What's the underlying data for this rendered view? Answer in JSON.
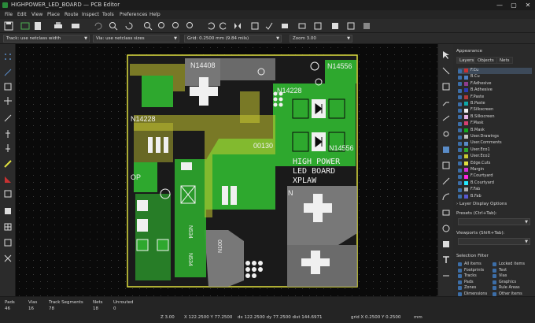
{
  "window": {
    "title": "HIGHPOWER_LED_BOARD — PCB Editor",
    "minimize": "—",
    "maximize": "▢",
    "close": "✕"
  },
  "menu": [
    "File",
    "Edit",
    "View",
    "Place",
    "Route",
    "Inspect",
    "Tools",
    "Preferences",
    "Help"
  ],
  "options": {
    "track": "Track: use netclass width",
    "via": "Via: use netclass sizes",
    "grid": "Grid: 0.2500 mm (9.84 mils)",
    "zoom": "Zoom 3.00"
  },
  "board": {
    "labels": {
      "n14408": "N14408",
      "n14556_top": "N14556",
      "n14228_right": "N14228",
      "n14228_left": "N14228",
      "n14556_mid": "N14556",
      "n00130": "00130",
      "title1": "HIGH POWER",
      "title2": "LED BOARD",
      "title3": "XPLAW",
      "n_lower": "N",
      "op": "OP",
      "n534_a": "N534",
      "n534_b": "N534",
      "n100": "N100"
    },
    "colors": {
      "fcu": "#c83232",
      "bcu": "#2ea82e",
      "yellow": "#c8c832",
      "silk": "#f0f0f0"
    }
  },
  "panel": {
    "title": "Appearance",
    "tabs": [
      "Layers",
      "Objects",
      "Nets"
    ],
    "layers": [
      {
        "name": "F.Cu",
        "color": "#c83232"
      },
      {
        "name": "B.Cu",
        "color": "#4d7fc4"
      },
      {
        "name": "F.Adhesive",
        "color": "#8f3d8f"
      },
      {
        "name": "B.Adhesive",
        "color": "#2b3bb3"
      },
      {
        "name": "F.Paste",
        "color": "#b33b3b"
      },
      {
        "name": "B.Paste",
        "color": "#0fa8a8"
      },
      {
        "name": "F.Silkscreen",
        "color": "#f0f0f0"
      },
      {
        "name": "B.Silkscreen",
        "color": "#e5b3e5"
      },
      {
        "name": "F.Mask",
        "color": "#d64073"
      },
      {
        "name": "B.Mask",
        "color": "#12a81e"
      },
      {
        "name": "User.Drawings",
        "color": "#c2c2c2"
      },
      {
        "name": "User.Comments",
        "color": "#5a8cc8"
      },
      {
        "name": "User.Eco1",
        "color": "#2ea82e"
      },
      {
        "name": "User.Eco2",
        "color": "#c8c832"
      },
      {
        "name": "Edge.Cuts",
        "color": "#e0e040"
      },
      {
        "name": "Margin",
        "color": "#d630d6"
      },
      {
        "name": "F.Courtyard",
        "color": "#ff26e2"
      },
      {
        "name": "B.Courtyard",
        "color": "#26e9ff"
      },
      {
        "name": "F.Fab",
        "color": "#afafaf"
      },
      {
        "name": "B.Fab",
        "color": "#5858d0"
      }
    ],
    "layer_display_options": "Layer Display Options",
    "presets_label": "Presets (Ctrl+Tab):",
    "viewports_label": "Viewports (Shift+Tab):",
    "selection_filter": "Selection Filter",
    "filters_left": [
      "All items",
      "Footprints",
      "Tracks",
      "Pads",
      "Zones",
      "Dimensions"
    ],
    "filters_right": [
      "Locked items",
      "Text",
      "Vias",
      "Graphics",
      "Rule Areas",
      "Other items"
    ]
  },
  "status": {
    "pads_label": "Pads",
    "pads": "46",
    "vias_label": "Vias",
    "vias": "16",
    "tracks_label": "Track Segments",
    "tracks": "78",
    "nets_label": "Nets",
    "nets": "18",
    "unrouted_label": "Unrouted",
    "unrouted": "0",
    "z": "Z 3.00",
    "xy": "X 122.2500  Y 77.2500",
    "dxy": "dx 122.2500  dy 77.2500  dist 144.6971",
    "grid": "grid X 0.2500  Y 0.2500",
    "units": "mm"
  }
}
